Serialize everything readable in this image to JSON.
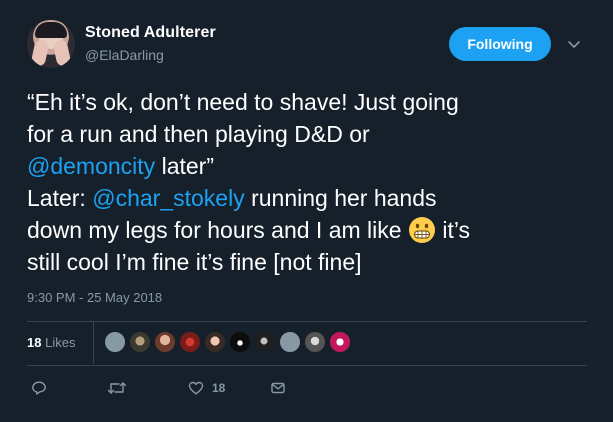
{
  "user": {
    "name": "Stoned Adulterer",
    "handle": "@ElaDarling"
  },
  "follow_button": "Following",
  "tweet": {
    "line1": "“Eh it’s ok, don’t need to shave! Just going",
    "line2": "for a run and then playing D&D or",
    "mention1": "@demoncity",
    "line3_rest": " later”",
    "line4_prefix": "Later: ",
    "mention2": "@char_stokely",
    "line4_rest": " running her hands",
    "line5": "down my legs for hours and I am like ",
    "line5_rest": " it’s",
    "line6": "still cool I’m fine it’s fine [not fine]"
  },
  "timestamp": "9:30 PM - 25 May 2018",
  "likes": {
    "count": "18",
    "label": "Likes"
  },
  "actions": {
    "like_count": "18"
  },
  "colors": {
    "background": "#15202b",
    "accent": "#1da1f2",
    "muted": "#8899a6"
  },
  "icons": {
    "reply": "reply-icon",
    "retweet": "retweet-icon",
    "like": "heart-icon",
    "dm": "envelope-icon",
    "chevron": "chevron-down-icon",
    "emoji": "grimacing-face-emoji"
  }
}
